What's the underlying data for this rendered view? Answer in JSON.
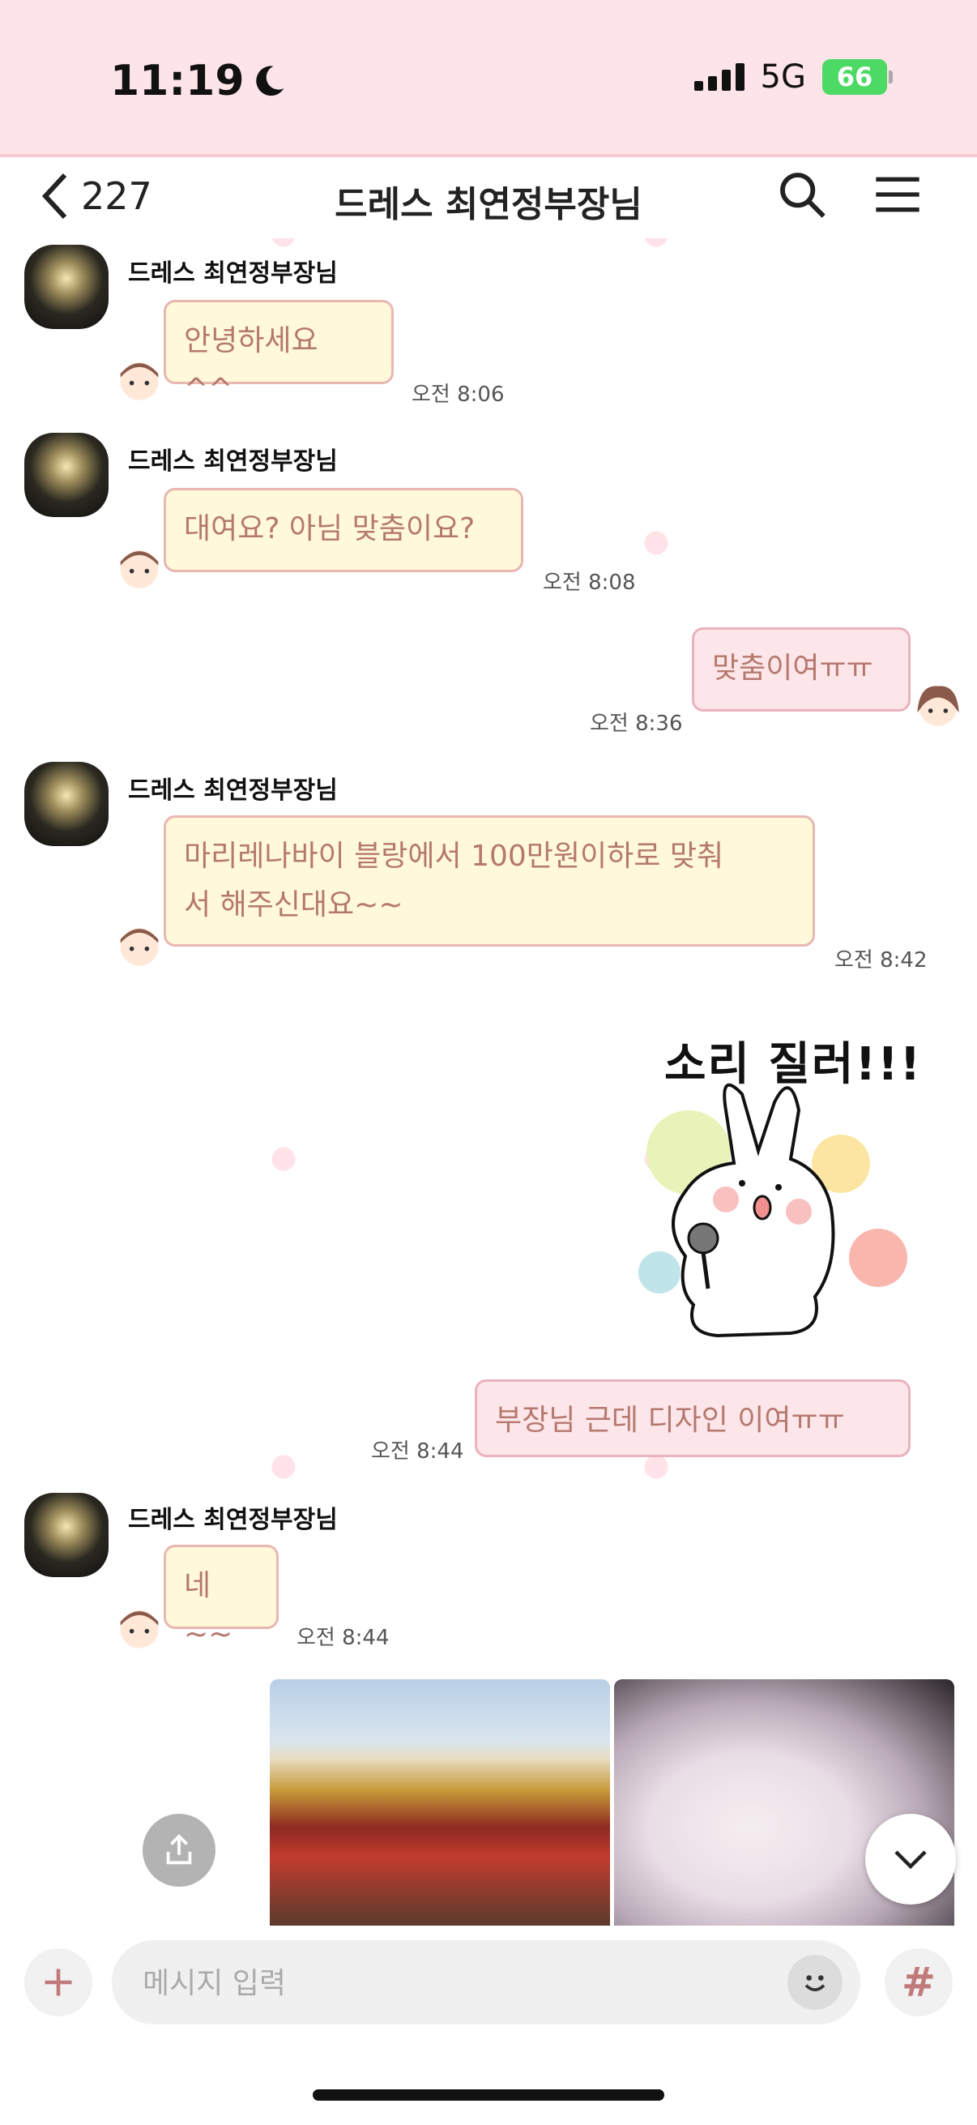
{
  "status": {
    "time": "11:19",
    "network": "5G",
    "battery": "66"
  },
  "header": {
    "back_count": "227",
    "title": "드레스 최연정부장님"
  },
  "messages": [
    {
      "sender": "드레스 최연정부장님",
      "text": "안녕하세요 ^^",
      "time": "오전 8:06"
    },
    {
      "sender": "드레스 최연정부장님",
      "text": "대여요? 아님 맞춤이요?",
      "time": "오전 8:08"
    },
    {
      "text": "맞춤이여ㅠㅠ",
      "time": "오전 8:36"
    },
    {
      "sender": "드레스 최연정부장님",
      "text_line1": "마리레나바이 블랑에서 100만원이하로 맞춰",
      "text_line2": "서 해주신대요~~",
      "time": "오전 8:42"
    },
    {
      "sticker_text": "소리 질러!!!"
    },
    {
      "text": "부장님 근데 디자인 이여ㅠㅠ",
      "time": "오전 8:44"
    },
    {
      "sender": "드레스 최연정부장님",
      "text": "네~~",
      "time": "오전 8:44"
    }
  ],
  "composer": {
    "placeholder": "메시지 입력"
  },
  "colors": {
    "status_bg": "#fde4e8",
    "in_bubble": "#fff8d9",
    "out_bubble": "#fde6ea",
    "bubble_text": "#b5786e"
  }
}
